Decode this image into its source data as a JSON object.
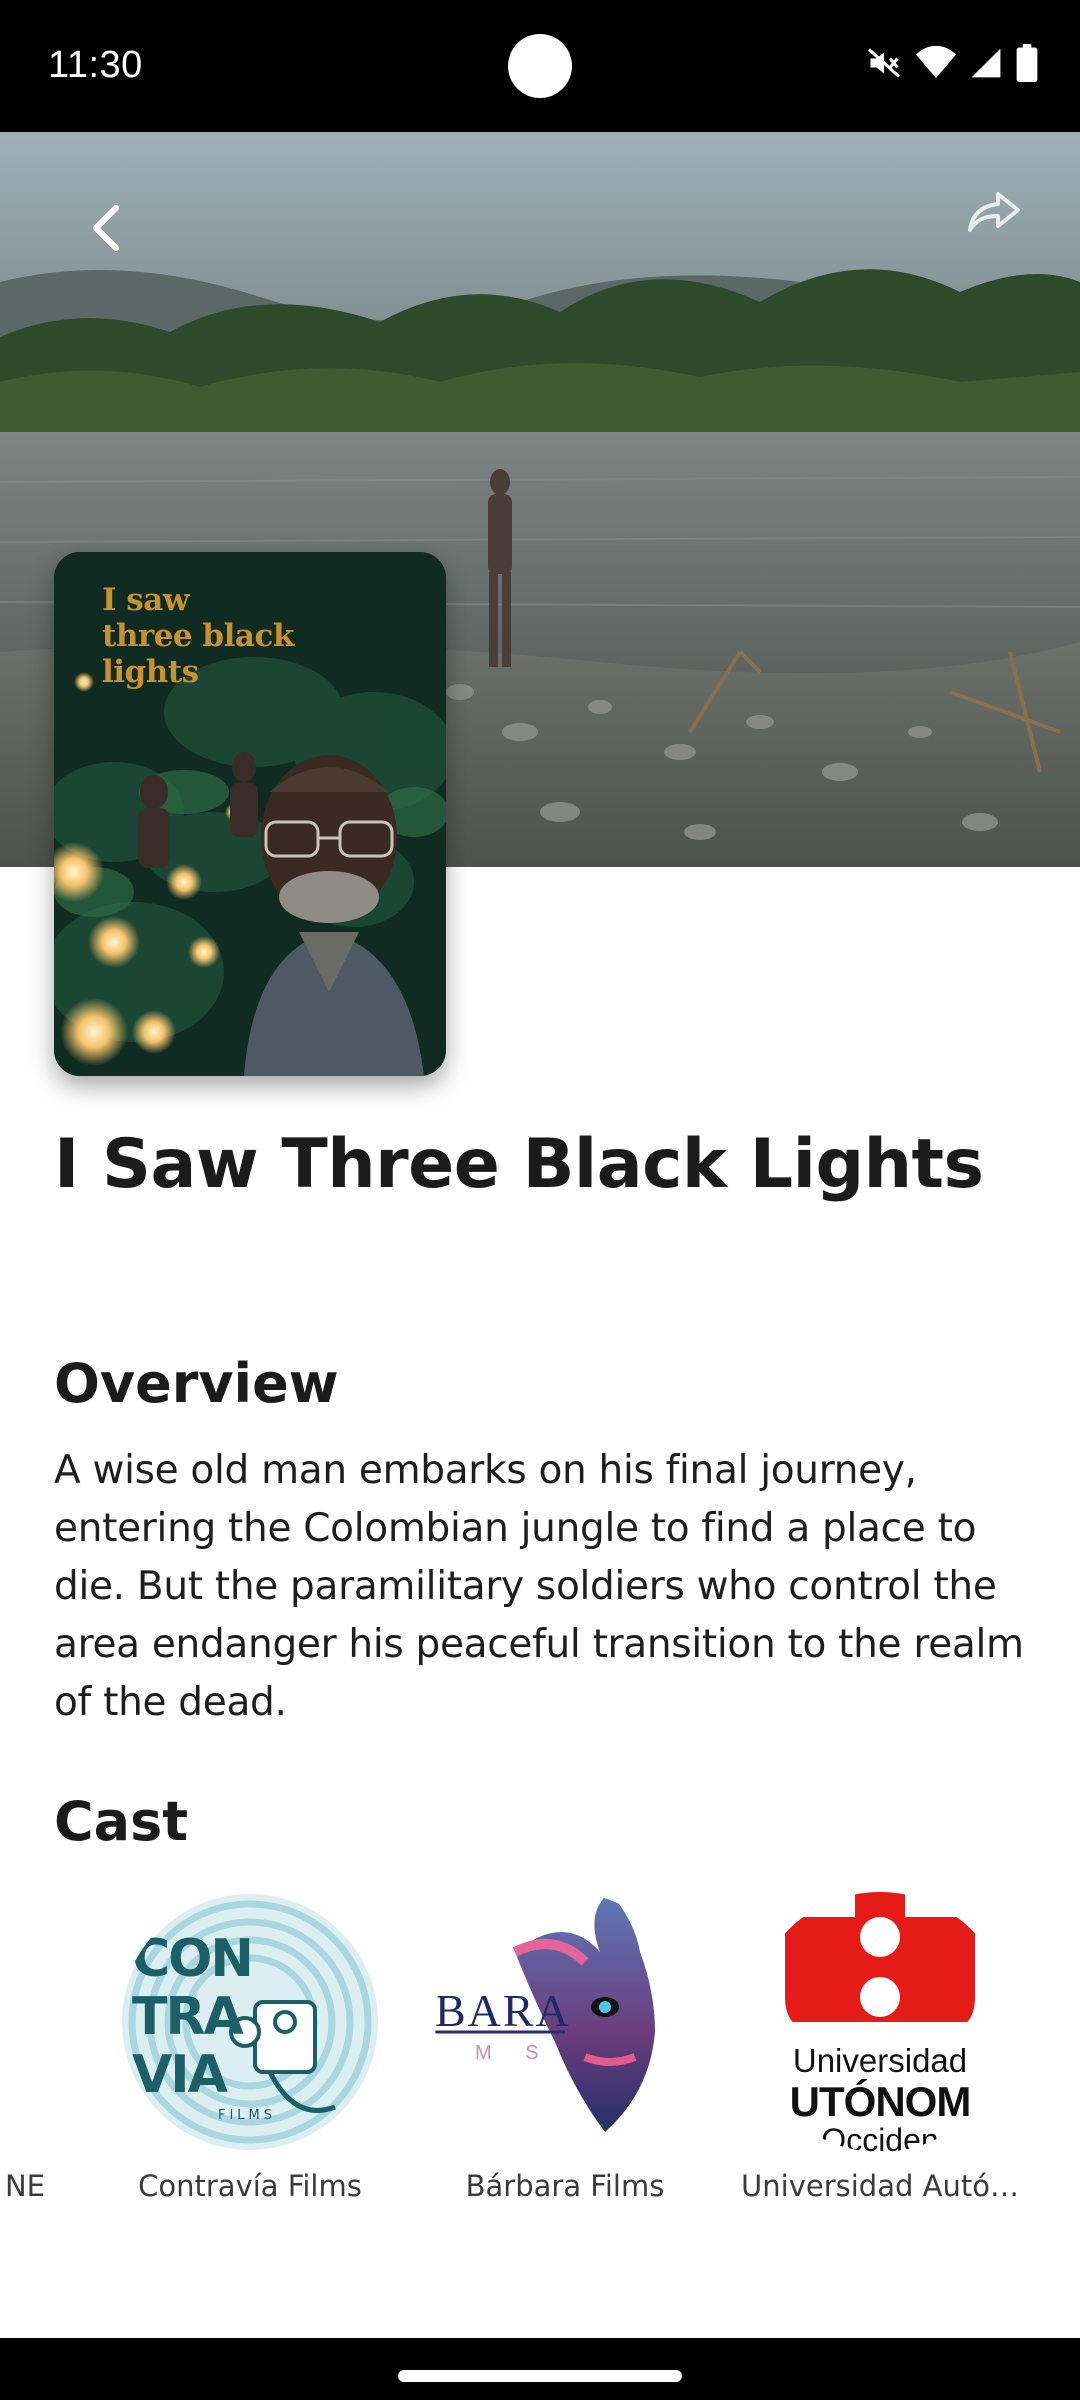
{
  "status_bar": {
    "time": "11:30",
    "icons": [
      "mute-icon",
      "wifi-icon",
      "signal-icon",
      "battery-icon"
    ]
  },
  "toolbar": {
    "back_icon": "chevron-left-icon",
    "share_icon": "share-arrow-icon"
  },
  "poster": {
    "title_lines": [
      "I saw",
      "three black",
      "lights"
    ]
  },
  "movie": {
    "title": "I Saw Three Black Lights"
  },
  "overview": {
    "heading": "Overview",
    "text": "A wise old man embarks on his final journey, entering the Colombian jungle to find a place to die. But the paramilitary soldiers who control the area endanger his peaceful transition to the realm of the dead."
  },
  "cast": {
    "heading": "Cast",
    "items": [
      {
        "name": "NE"
      },
      {
        "name": "Contravía Films"
      },
      {
        "name": "Bárbara Films"
      },
      {
        "name": "Universidad Autó…"
      }
    ]
  },
  "logos": {
    "contravia_lines": [
      "CON",
      "TRA",
      "VIA",
      "FILMS"
    ],
    "barbara_text": "BARA",
    "barbara_sub": "M S",
    "universidad_lines": [
      "Universidad",
      "UTÓNOM",
      "Occiden"
    ]
  },
  "colors": {
    "title": "#1b1b1b",
    "poster_gold": "#c8902e",
    "contravia_teal": "#1d5f66",
    "universidad_red": "#e41b17"
  }
}
